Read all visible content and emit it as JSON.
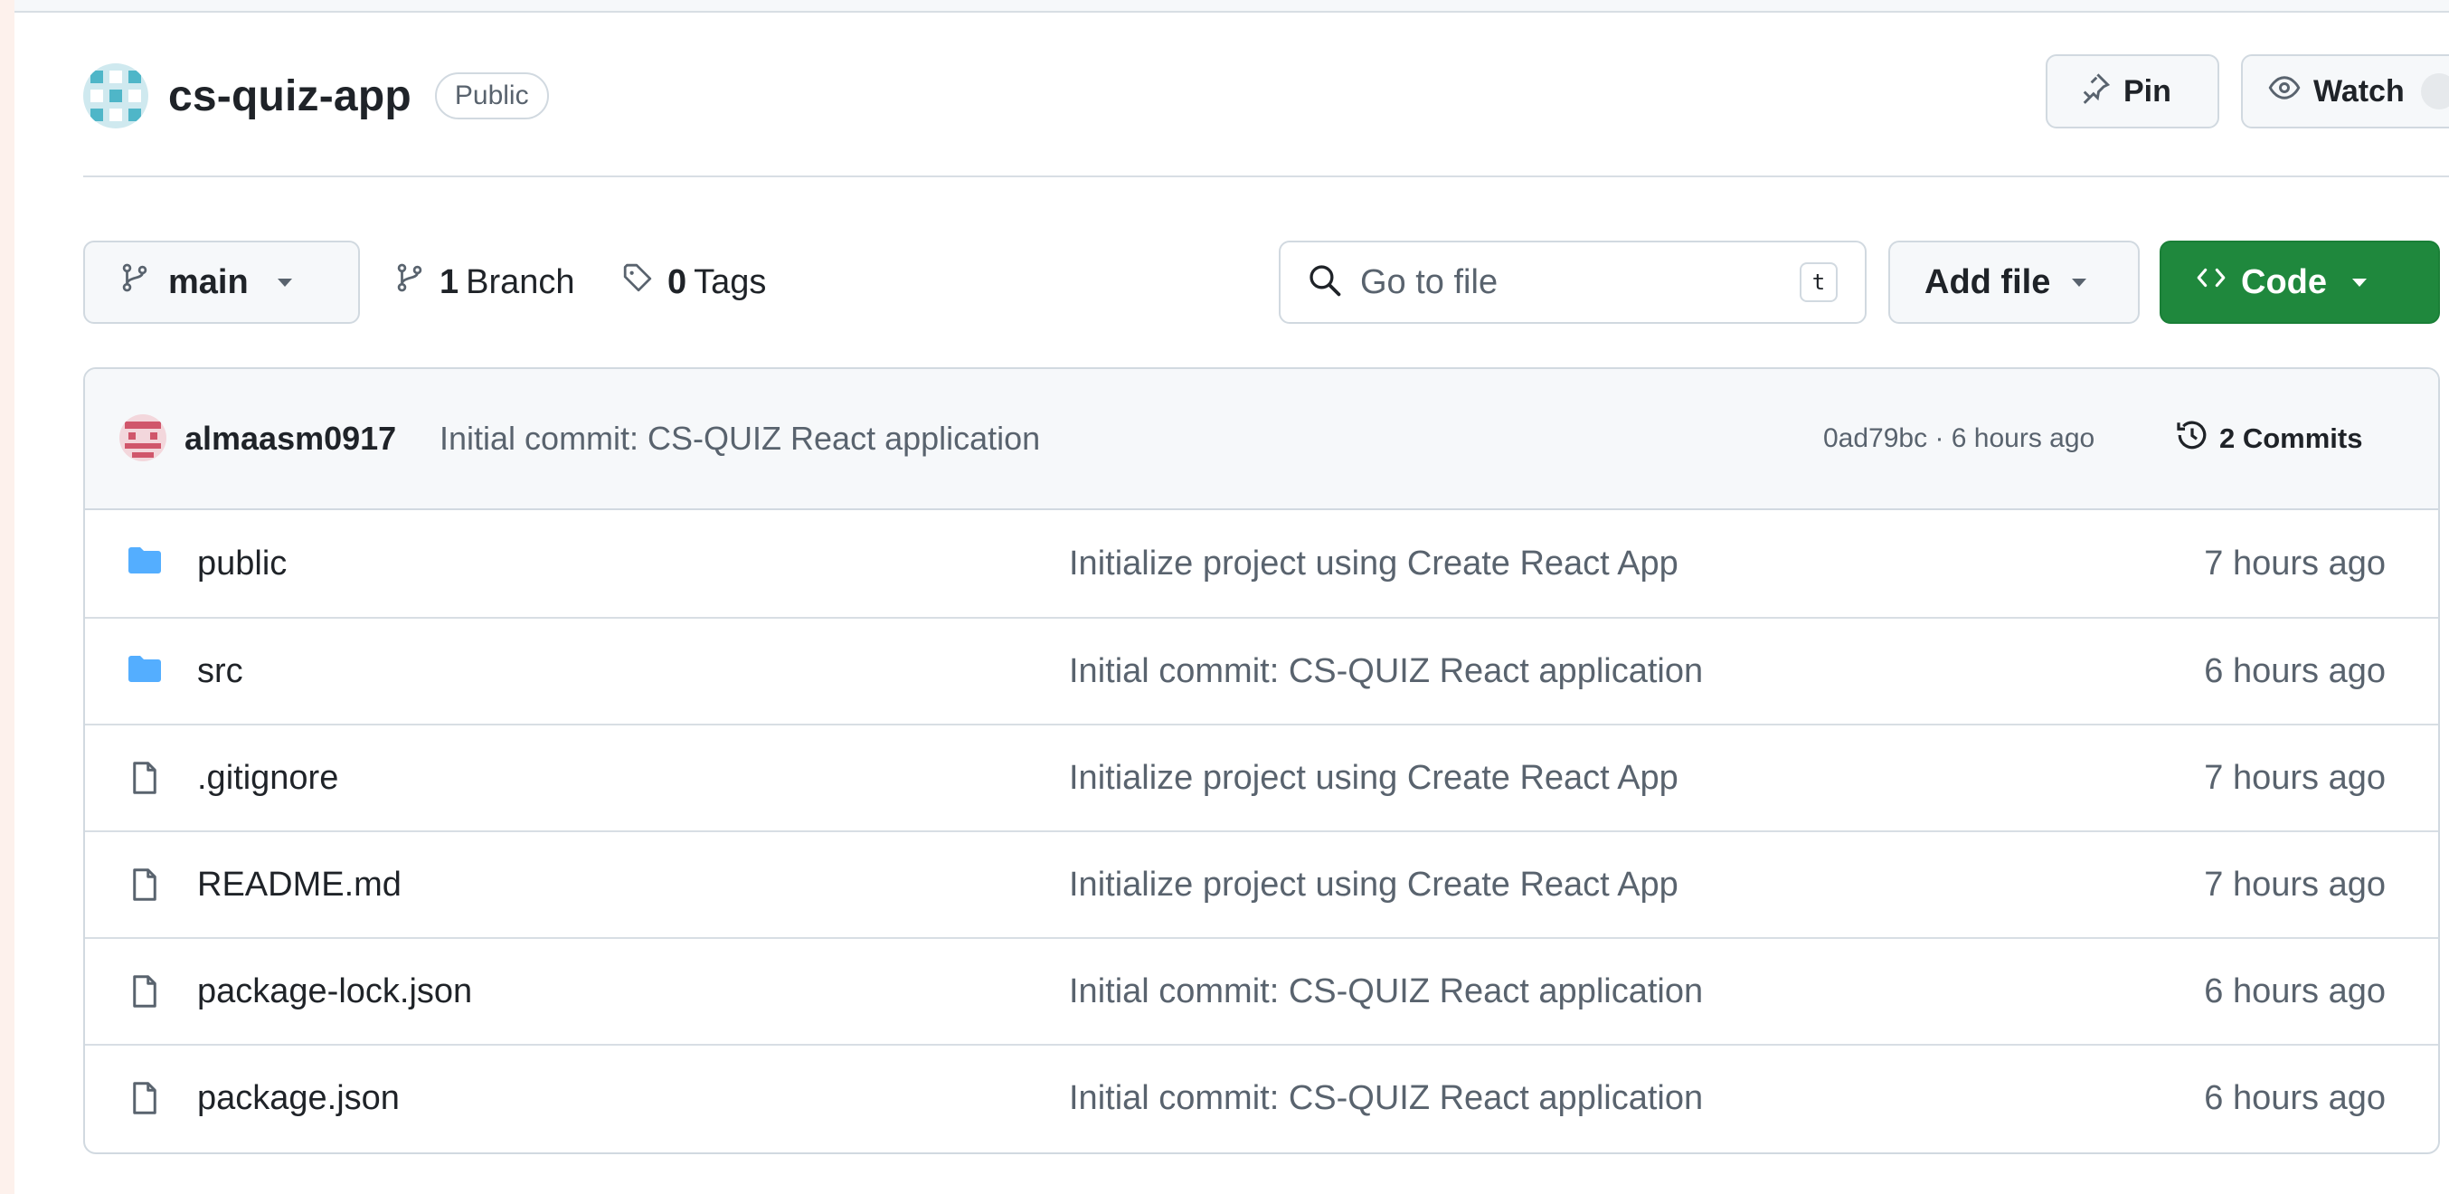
{
  "repo": {
    "name": "cs-quiz-app",
    "visibility": "Public",
    "pin_label": "Pin",
    "watch_label": "Watch"
  },
  "toolbar": {
    "branch": "main",
    "branches_count": "1",
    "branches_label": "Branch",
    "tags_count": "0",
    "tags_label": "Tags",
    "search_placeholder": "Go to file",
    "search_shortcut": "t",
    "add_file_label": "Add file",
    "code_label": "Code"
  },
  "latest_commit": {
    "author": "almaasm0917",
    "message": "Initial commit: CS-QUIZ React application",
    "meta": "0ad79bc · 6 hours ago",
    "commits_label": "2 Commits"
  },
  "files": [
    {
      "name": "public",
      "type": "folder",
      "commit": "Initialize project using Create React App",
      "time": "7 hours ago"
    },
    {
      "name": "src",
      "type": "folder",
      "commit": "Initial commit: CS-QUIZ React application",
      "time": "6 hours ago"
    },
    {
      "name": ".gitignore",
      "type": "file",
      "commit": "Initialize project using Create React App",
      "time": "7 hours ago"
    },
    {
      "name": "README.md",
      "type": "file",
      "commit": "Initialize project using Create React App",
      "time": "7 hours ago"
    },
    {
      "name": "package-lock.json",
      "type": "file",
      "commit": "Initial commit: CS-QUIZ React application",
      "time": "6 hours ago"
    },
    {
      "name": "package.json",
      "type": "file",
      "commit": "Initial commit: CS-QUIZ React application",
      "time": "6 hours ago"
    }
  ],
  "colors": {
    "primary_button": "#1f883d",
    "folder": "#54aeff",
    "muted_text": "#59636e",
    "border": "#d1d9e0"
  }
}
